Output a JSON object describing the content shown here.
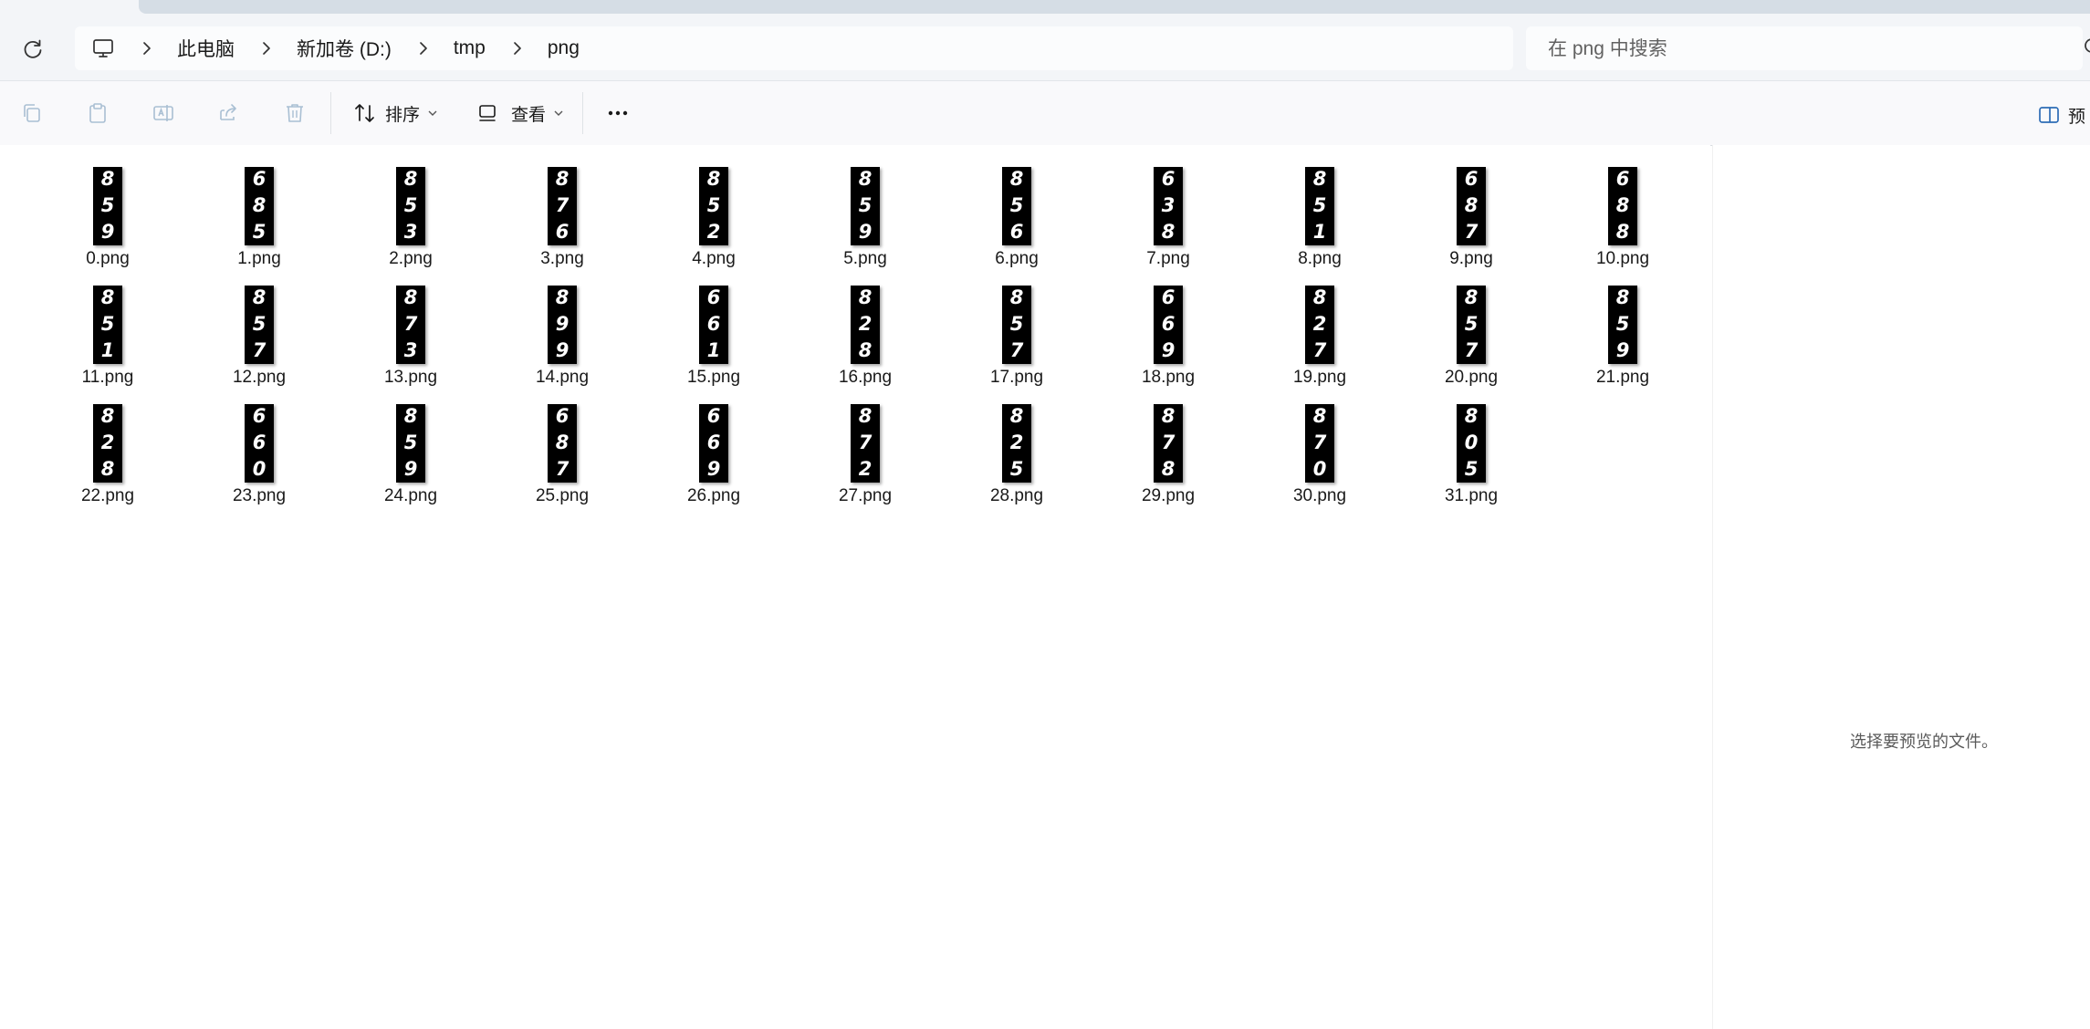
{
  "breadcrumb": {
    "segments": [
      "此电脑",
      "新加卷 (D:)",
      "tmp",
      "png"
    ]
  },
  "search": {
    "placeholder": "在 png 中搜索"
  },
  "toolbar": {
    "sort_label": "排序",
    "view_label": "查看",
    "preview_label": "预"
  },
  "preview": {
    "message": "选择要预览的文件。"
  },
  "files": [
    {
      "name": "0.png",
      "digits": [
        "8",
        "5",
        "9"
      ]
    },
    {
      "name": "1.png",
      "digits": [
        "6",
        "8",
        "5"
      ]
    },
    {
      "name": "2.png",
      "digits": [
        "8",
        "5",
        "3"
      ]
    },
    {
      "name": "3.png",
      "digits": [
        "8",
        "7",
        "6"
      ]
    },
    {
      "name": "4.png",
      "digits": [
        "8",
        "5",
        "2"
      ]
    },
    {
      "name": "5.png",
      "digits": [
        "8",
        "5",
        "9"
      ]
    },
    {
      "name": "6.png",
      "digits": [
        "8",
        "5",
        "6"
      ]
    },
    {
      "name": "7.png",
      "digits": [
        "6",
        "3",
        "8"
      ]
    },
    {
      "name": "8.png",
      "digits": [
        "8",
        "5",
        "1"
      ]
    },
    {
      "name": "9.png",
      "digits": [
        "6",
        "8",
        "7"
      ]
    },
    {
      "name": "10.png",
      "digits": [
        "6",
        "8",
        "8"
      ]
    },
    {
      "name": "11.png",
      "digits": [
        "8",
        "5",
        "1"
      ]
    },
    {
      "name": "12.png",
      "digits": [
        "8",
        "5",
        "7"
      ]
    },
    {
      "name": "13.png",
      "digits": [
        "8",
        "7",
        "3"
      ]
    },
    {
      "name": "14.png",
      "digits": [
        "8",
        "9",
        "9"
      ]
    },
    {
      "name": "15.png",
      "digits": [
        "6",
        "6",
        "1"
      ]
    },
    {
      "name": "16.png",
      "digits": [
        "8",
        "2",
        "8"
      ]
    },
    {
      "name": "17.png",
      "digits": [
        "8",
        "5",
        "7"
      ]
    },
    {
      "name": "18.png",
      "digits": [
        "6",
        "6",
        "9"
      ]
    },
    {
      "name": "19.png",
      "digits": [
        "8",
        "2",
        "7"
      ]
    },
    {
      "name": "20.png",
      "digits": [
        "8",
        "5",
        "7"
      ]
    },
    {
      "name": "21.png",
      "digits": [
        "8",
        "5",
        "9"
      ]
    },
    {
      "name": "22.png",
      "digits": [
        "8",
        "2",
        "8"
      ]
    },
    {
      "name": "23.png",
      "digits": [
        "6",
        "6",
        "0"
      ]
    },
    {
      "name": "24.png",
      "digits": [
        "8",
        "5",
        "9"
      ]
    },
    {
      "name": "25.png",
      "digits": [
        "6",
        "8",
        "7"
      ]
    },
    {
      "name": "26.png",
      "digits": [
        "6",
        "6",
        "9"
      ]
    },
    {
      "name": "27.png",
      "digits": [
        "8",
        "7",
        "2"
      ]
    },
    {
      "name": "28.png",
      "digits": [
        "8",
        "2",
        "5"
      ]
    },
    {
      "name": "29.png",
      "digits": [
        "8",
        "7",
        "8"
      ]
    },
    {
      "name": "30.png",
      "digits": [
        "8",
        "7",
        "0"
      ]
    },
    {
      "name": "31.png",
      "digits": [
        "8",
        "0",
        "5"
      ]
    }
  ]
}
